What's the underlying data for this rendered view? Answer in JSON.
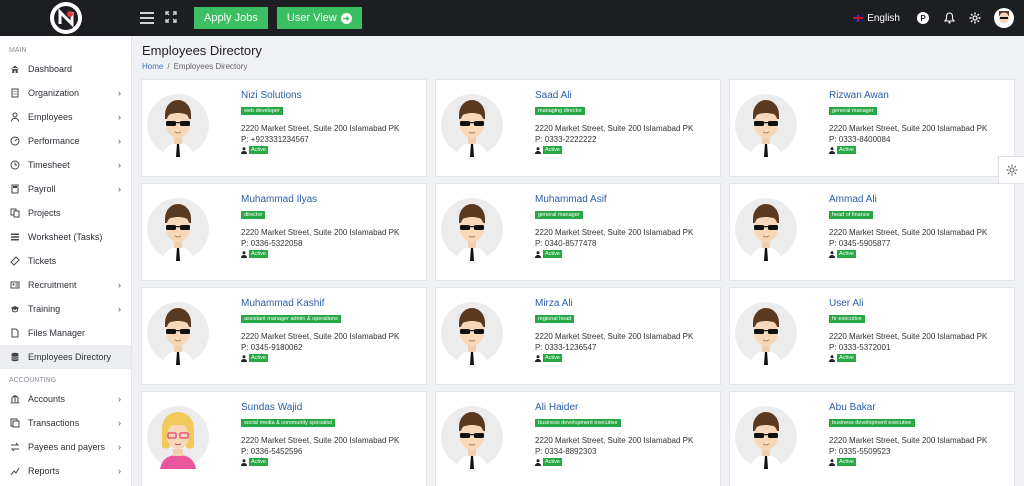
{
  "topbar": {
    "apply_jobs": "Apply Jobs",
    "user_view": "User View",
    "language": "English",
    "p_icon": "P"
  },
  "sidebar": {
    "main_label": "MAIN",
    "accounting_label": "ACCOUNTING",
    "items": [
      {
        "label": "Dashboard",
        "icon": "home-icon",
        "chevron": false
      },
      {
        "label": "Organization",
        "icon": "building-icon",
        "chevron": true
      },
      {
        "label": "Employees",
        "icon": "user-icon",
        "chevron": true
      },
      {
        "label": "Performance",
        "icon": "gauge-icon",
        "chevron": true
      },
      {
        "label": "Timesheet",
        "icon": "clock-icon",
        "chevron": true
      },
      {
        "label": "Payroll",
        "icon": "calculator-icon",
        "chevron": true
      },
      {
        "label": "Projects",
        "icon": "projects-icon",
        "chevron": false
      },
      {
        "label": "Worksheet (Tasks)",
        "icon": "tasks-icon",
        "chevron": false
      },
      {
        "label": "Tickets",
        "icon": "ticket-icon",
        "chevron": false
      },
      {
        "label": "Recruitment",
        "icon": "recruitment-icon",
        "chevron": true
      },
      {
        "label": "Training",
        "icon": "graduation-cap-icon",
        "chevron": true
      },
      {
        "label": "Files Manager",
        "icon": "file-icon",
        "chevron": false
      },
      {
        "label": "Employees Directory",
        "icon": "database-icon",
        "chevron": false,
        "active": true
      }
    ],
    "accounting_items": [
      {
        "label": "Accounts",
        "icon": "bank-icon",
        "chevron": true
      },
      {
        "label": "Transactions",
        "icon": "transactions-icon",
        "chevron": true
      },
      {
        "label": "Payees and payers",
        "icon": "exchange-icon",
        "chevron": true
      },
      {
        "label": "Reports",
        "icon": "chart-icon",
        "chevron": true
      }
    ]
  },
  "page": {
    "title": "Employees Directory",
    "breadcrumb_home": "Home",
    "breadcrumb_sep": "/",
    "breadcrumb_current": "Employees Directory"
  },
  "employees": [
    {
      "name": "Nizi Solutions",
      "role": "web developer",
      "address": "2220 Market Street, Suite 200 Islamabad PK",
      "phone": "P: +923331234567",
      "status": "Active",
      "gender": "male"
    },
    {
      "name": "Saad Ali",
      "role": "managing director",
      "address": "2220 Market Street, Suite 200 Islamabad PK",
      "phone": "P: 0333-2222222",
      "status": "Active",
      "gender": "male"
    },
    {
      "name": "Rizwan Awan",
      "role": "general manager",
      "address": "2220 Market Street, Suite 200 Islamabad PK",
      "phone": "P: 0333-8400084",
      "status": "Active",
      "gender": "male"
    },
    {
      "name": "Muhammad Ilyas",
      "role": "director",
      "address": "2220 Market Street, Suite 200 Islamabad PK",
      "phone": "P: 0336-5322058",
      "status": "Active",
      "gender": "male"
    },
    {
      "name": "Muhammad Asif",
      "role": "general manager",
      "address": "2220 Market Street, Suite 200 Islamabad PK",
      "phone": "P: 0340-8577478",
      "status": "Active",
      "gender": "male"
    },
    {
      "name": "Ammad Ali",
      "role": "head of finance",
      "address": "2220 Market Street, Suite 200 Islamabad PK",
      "phone": "P: 0345-5905877",
      "status": "Active",
      "gender": "male"
    },
    {
      "name": "Muhammad Kashif",
      "role": "assistant manager admin & operations",
      "address": "2220 Market Street, Suite 200 Islamabad PK",
      "phone": "P: 0345-9180062",
      "status": "Active",
      "gender": "male"
    },
    {
      "name": "Mirza Ali",
      "role": "regional head",
      "address": "2220 Market Street, Suite 200 Islamabad PK",
      "phone": "P: 0333-1236547",
      "status": "Active",
      "gender": "male"
    },
    {
      "name": "User Ali",
      "role": "hr executive",
      "address": "2220 Market Street, Suite 200 Islamabad PK",
      "phone": "P: 0333-5372001",
      "status": "Active",
      "gender": "male"
    },
    {
      "name": "Sundas Wajid",
      "role": "social media & community specialist",
      "address": "2220 Market Street, Suite 200 Islamabad PK",
      "phone": "P: 0336-5452596",
      "status": "Active",
      "gender": "female"
    },
    {
      "name": "Ali Haider",
      "role": "business development executive",
      "address": "2220 Market Street, Suite 200 Islamabad PK",
      "phone": "P: 0334-8892303",
      "status": "Active",
      "gender": "male"
    },
    {
      "name": "Abu Bakar",
      "role": "business development executive",
      "address": "2220 Market Street, Suite 200 Islamabad PK",
      "phone": "P: 0335-5509523",
      "status": "Active",
      "gender": "male"
    }
  ],
  "colors": {
    "topbar_bg": "#1d1e22",
    "accent_green": "#3bbf62",
    "badge_green": "#28a745",
    "link_blue": "#2a5ea8"
  }
}
